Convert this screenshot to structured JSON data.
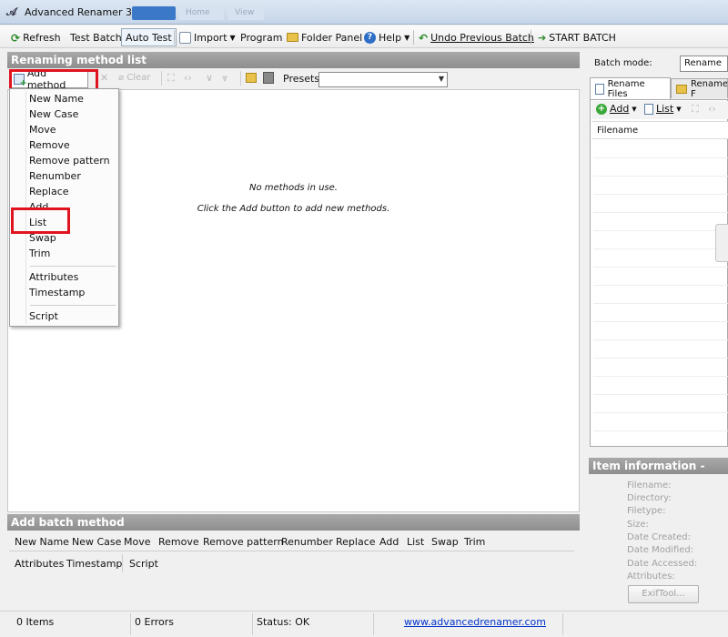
{
  "window": {
    "title": "Advanced Renamer 3.64",
    "tabs": [
      "",
      "Home",
      "View"
    ]
  },
  "toolbar": {
    "refresh": "Refresh",
    "test_batch": "Test Batch",
    "auto_test": "Auto Test",
    "import": "Import",
    "program": "Program",
    "folder_panel": "Folder Panel",
    "help": "Help",
    "undo": "Undo Previous Batch",
    "start": "START BATCH"
  },
  "method_panel": {
    "header": "Renaming method list",
    "add_method": "Add method",
    "clear": "Clear",
    "presets_label": "Presets:",
    "presets_value": "",
    "empty_line1": "No methods in use.",
    "empty_line2": "Click the Add button to add new methods."
  },
  "dropdown": {
    "group1": [
      "New Name",
      "New Case",
      "Move",
      "Remove",
      "Remove pattern",
      "Renumber",
      "Replace",
      "Add",
      "List",
      "Swap",
      "Trim"
    ],
    "group2": [
      "Attributes",
      "Timestamp"
    ],
    "group3": [
      "Script"
    ],
    "highlighted": "List"
  },
  "batch_panel": {
    "header": "Add batch method",
    "row1": [
      "New Name",
      "New Case",
      "Move",
      "Remove",
      "Remove pattern",
      "Renumber",
      "Replace",
      "Add",
      "List",
      "Swap",
      "Trim"
    ],
    "row2": [
      "Attributes",
      "Timestamp",
      "Script"
    ]
  },
  "right_panel": {
    "batch_mode_label": "Batch mode:",
    "batch_mode_value": "Rename",
    "tab_files": "Rename Files",
    "tab_folders": "Rename F",
    "add": "Add",
    "list": "List",
    "column_filename": "Filename",
    "item_info_header": "Item information -",
    "info_fields": [
      "Filename:",
      "Directory:",
      "Filetype:",
      "Size:",
      "Date Created:",
      "Date Modified:",
      "Date Accessed:",
      "Attributes:"
    ],
    "exif_button": "ExifTool..."
  },
  "status": {
    "items": "0 Items",
    "errors": "0 Errors",
    "status": "Status: OK",
    "link": "www.advancedrenamer.com"
  },
  "colors": {
    "highlight": "#e0141e",
    "header_gray": "#9a9a9a",
    "link": "#0033cc"
  }
}
